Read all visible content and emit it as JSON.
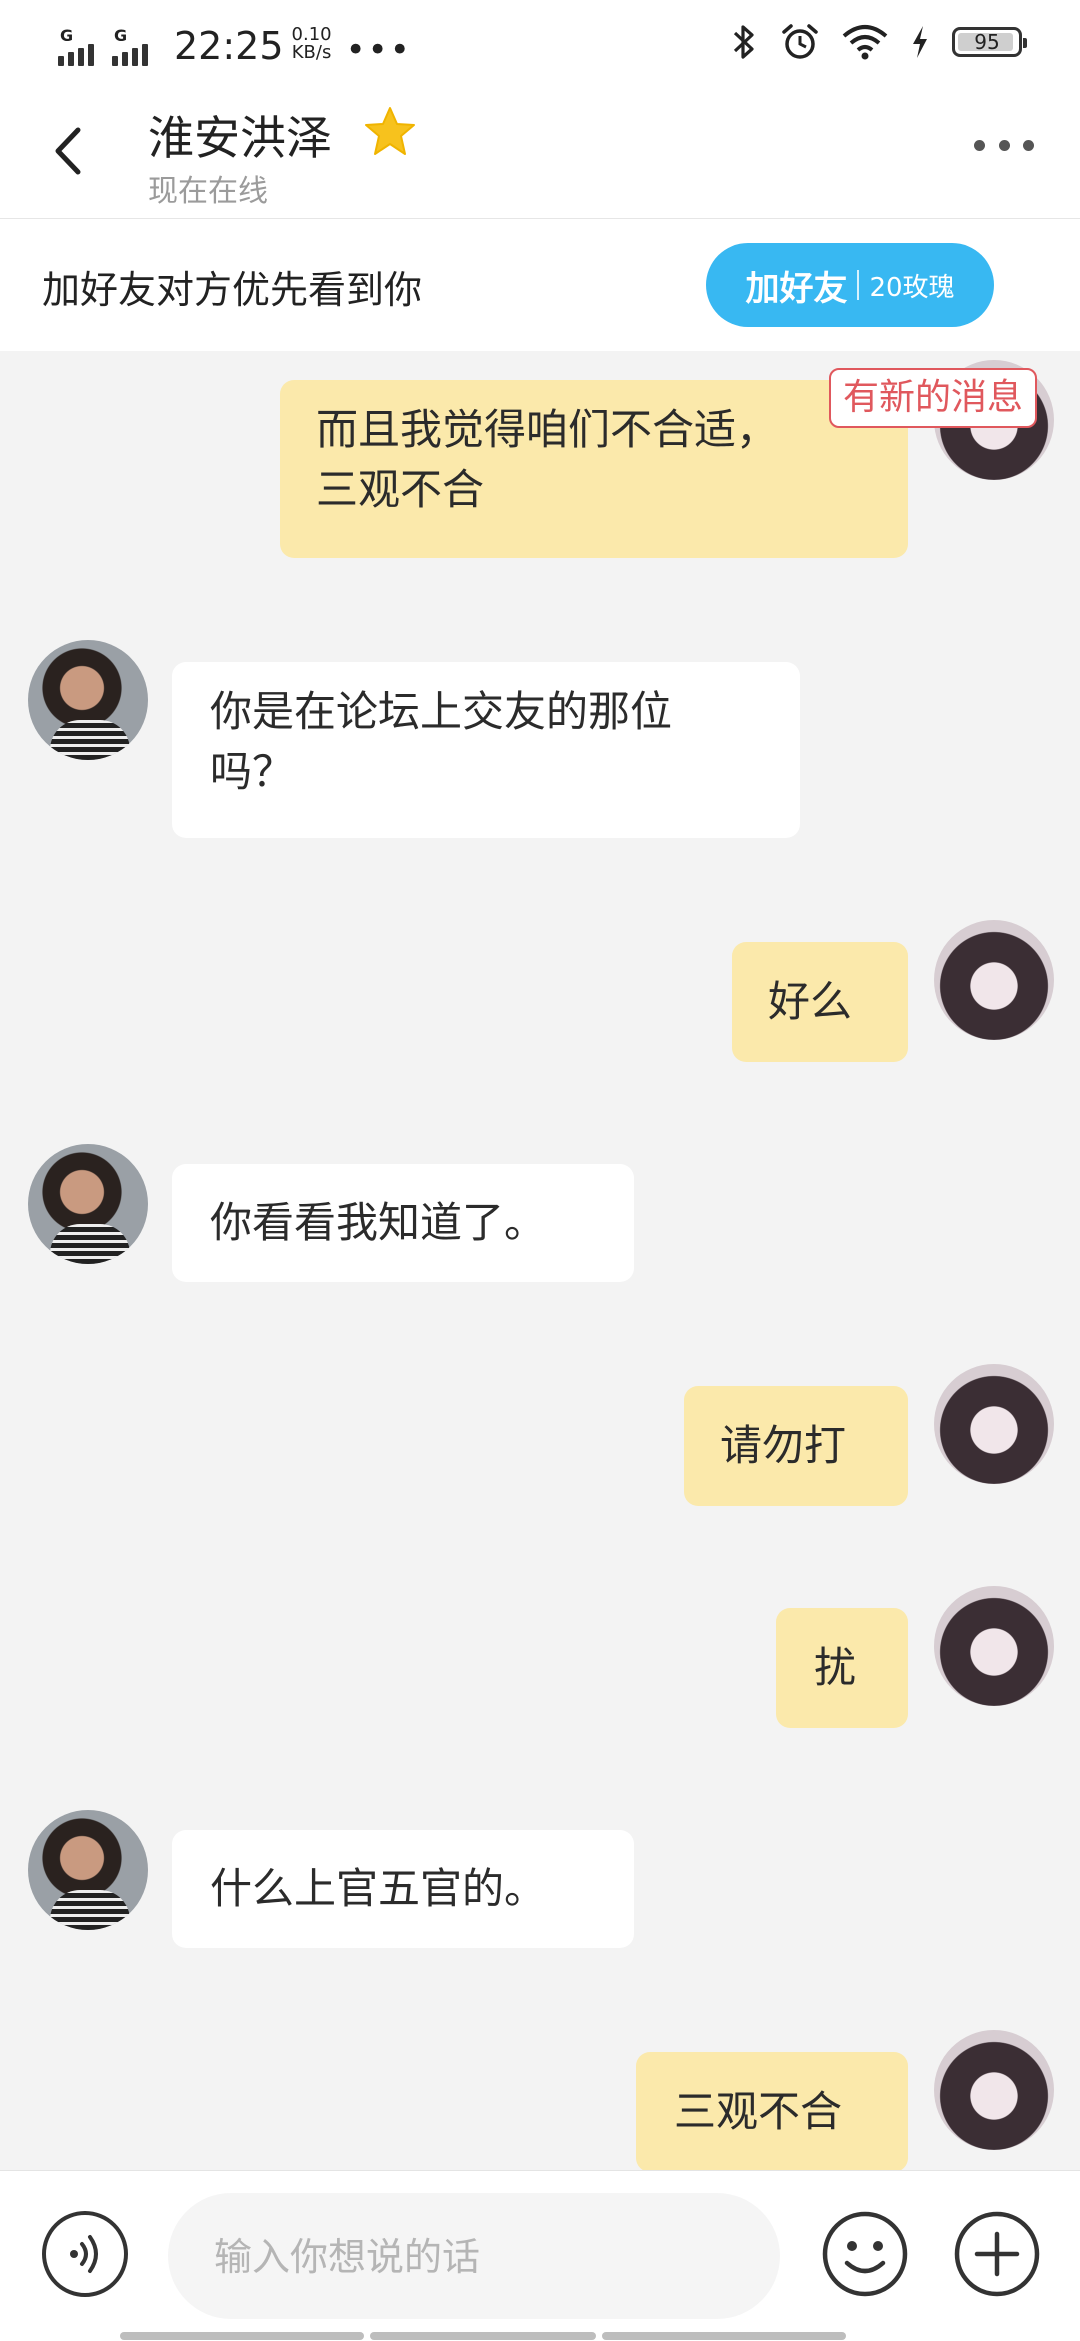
{
  "status_bar": {
    "signal_1_label": "G",
    "signal_2_label": "G",
    "time": "22:25",
    "speed_value": "0.10",
    "speed_unit": "KB/s",
    "more": "•••",
    "battery": "95",
    "icons": [
      "bluetooth-icon",
      "alarm-icon",
      "wifi-icon",
      "charging-icon"
    ]
  },
  "header": {
    "title": "淮安洪泽",
    "subtitle": "现在在线",
    "star_color": "#f7c21d"
  },
  "add_friend_bar": {
    "prompt": "加好友对方优先看到你",
    "button_main": "加好友",
    "button_price": "20玫瑰",
    "button_color": "#38b8f2"
  },
  "chat": {
    "new_messages_badge": "有新的消息",
    "messages": [
      {
        "from": "me",
        "text_line1": "而且我觉得咱们不合适，",
        "text_line2": "三观不合"
      },
      {
        "from": "them",
        "text_line1": "你是在论坛上交友的那位",
        "text_line2": "吗？"
      },
      {
        "from": "me",
        "text": "好么"
      },
      {
        "from": "them",
        "text": "你看看我知道了。"
      },
      {
        "from": "me",
        "text": "请勿打"
      },
      {
        "from": "me",
        "text": "扰"
      },
      {
        "from": "them",
        "text": "什么上官五官的。"
      },
      {
        "from": "me",
        "text": "三观不合"
      }
    ],
    "me_bubble_color": "#fbe9ab",
    "them_bubble_color": "#ffffff"
  },
  "input_bar": {
    "placeholder": "输入你想说的话"
  }
}
